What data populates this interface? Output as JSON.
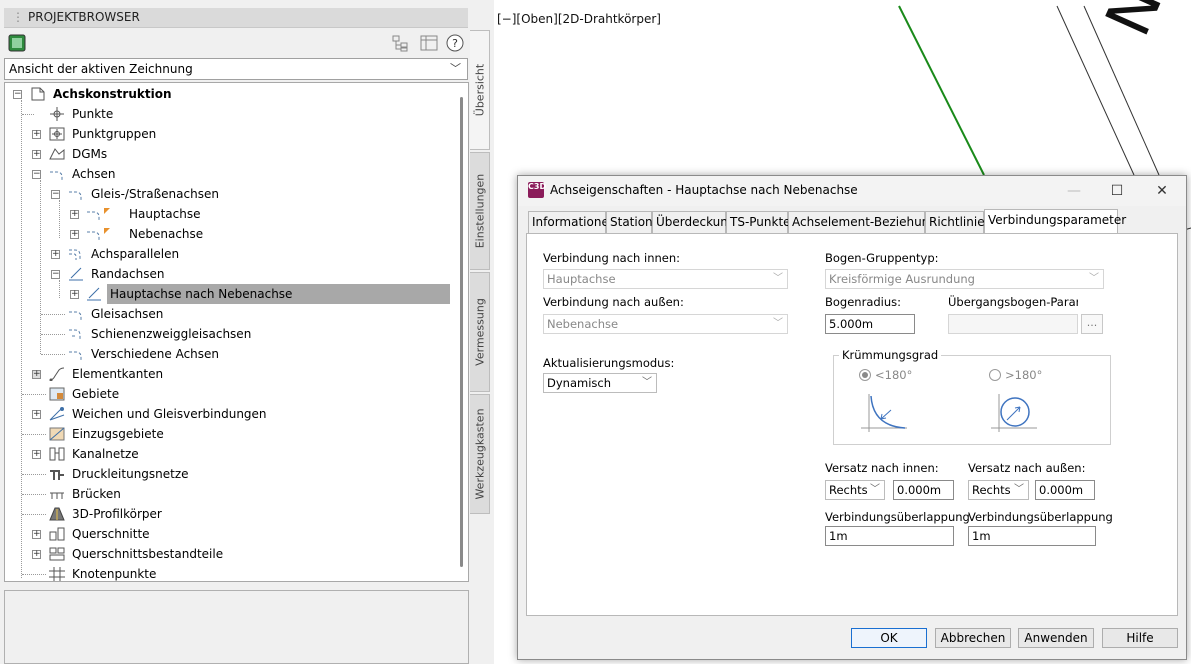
{
  "browser": {
    "title": "PROJEKTBROWSER",
    "view_select": "Ansicht der aktiven Zeichnung",
    "tree": [
      {
        "label": "Achskonstruktion",
        "icon": "drawing-icon"
      },
      {
        "label": "Punkte",
        "icon": "point-icon"
      },
      {
        "label": "Punktgruppen",
        "icon": "point-group-icon"
      },
      {
        "label": "DGMs",
        "icon": "surface-icon"
      },
      {
        "label": "Achsen",
        "icon": "alignment-icon"
      },
      {
        "label": "Gleis-/Straßenachsen",
        "icon": "alignment-icon"
      },
      {
        "label": "Hauptachse",
        "icon": "alignment-icon"
      },
      {
        "label": "Nebenachse",
        "icon": "alignment-icon"
      },
      {
        "label": "Achsparallelen",
        "icon": "offset-alignment-icon"
      },
      {
        "label": "Randachsen",
        "icon": "curb-return-icon"
      },
      {
        "label": "Hauptachse nach Nebenachse",
        "icon": "curb-return-icon"
      },
      {
        "label": "Gleisachsen",
        "icon": "alignment-icon"
      },
      {
        "label": "Schienenzweiggleisachsen",
        "icon": "rail-alignment-icon"
      },
      {
        "label": "Verschiedene Achsen",
        "icon": "alignment-icon"
      },
      {
        "label": "Elementkanten",
        "icon": "feature-line-icon"
      },
      {
        "label": "Gebiete",
        "icon": "site-icon"
      },
      {
        "label": "Weichen und Gleisverbindungen",
        "icon": "turnout-icon"
      },
      {
        "label": "Einzugsgebiete",
        "icon": "catchment-icon"
      },
      {
        "label": "Kanalnetze",
        "icon": "pipe-network-icon"
      },
      {
        "label": "Druckleitungsnetze",
        "icon": "pressure-network-icon"
      },
      {
        "label": "Brücken",
        "icon": "bridge-icon"
      },
      {
        "label": "3D-Profilkörper",
        "icon": "corridor-icon"
      },
      {
        "label": "Querschnitte",
        "icon": "assembly-icon"
      },
      {
        "label": "Querschnittsbestandteile",
        "icon": "subassembly-icon"
      },
      {
        "label": "Knotenpunkte",
        "icon": "intersection-icon"
      }
    ]
  },
  "side_tabs": [
    "Übersicht",
    "Einstellungen",
    "Vermessung",
    "Werkzeugkasten"
  ],
  "drawing": {
    "viewport_label": "[−][Oben][2D-Drahtkörper]",
    "street_text": "Neb"
  },
  "dialog": {
    "app_icon_text": "C3D",
    "title": "Achseigenschaften - Hauptachse nach Nebenachse",
    "tabs": [
      "Informationen",
      "Station",
      "Überdeckung",
      "TS-Punkte",
      "Achselement-Beziehungen",
      "Richtlinien",
      "Verbindungsparameter"
    ],
    "active_tab": "Verbindungsparameter",
    "conn_inner_label": "Verbindung nach innen:",
    "conn_inner_value": "Hauptachse",
    "conn_outer_label": "Verbindung nach außen:",
    "conn_outer_value": "Nebenachse",
    "update_mode_label": "Aktualisierungsmodus:",
    "update_mode_value": "Dynamisch",
    "arc_group_label": "Bogen-Gruppentyp:",
    "arc_group_value": "Kreisförmige Ausrundung",
    "arc_radius_label": "Bogenradius:",
    "arc_radius_value": "5.000m",
    "spiral_label": "Übergangsbogen-Paramete",
    "ellipsis": "...",
    "curvature_group": "Krümmungsgrad",
    "curv_lt": "<180°",
    "curv_gt": ">180°",
    "curv_selected": "<180°",
    "offset_inner_label": "Versatz nach innen:",
    "offset_inner_side": "Rechts",
    "offset_inner_value": "0.000m",
    "offset_outer_label": "Versatz nach außen:",
    "offset_outer_side": "Rechts",
    "offset_outer_value": "0.000m",
    "overlap_inner_label": "Verbindungsüberlappung",
    "overlap_inner_value": "1m",
    "overlap_outer_label": "Verbindungsüberlappung",
    "overlap_outer_value": "1m",
    "buttons": {
      "ok": "OK",
      "cancel": "Abbrechen",
      "apply": "Anwenden",
      "help": "Hilfe"
    }
  }
}
